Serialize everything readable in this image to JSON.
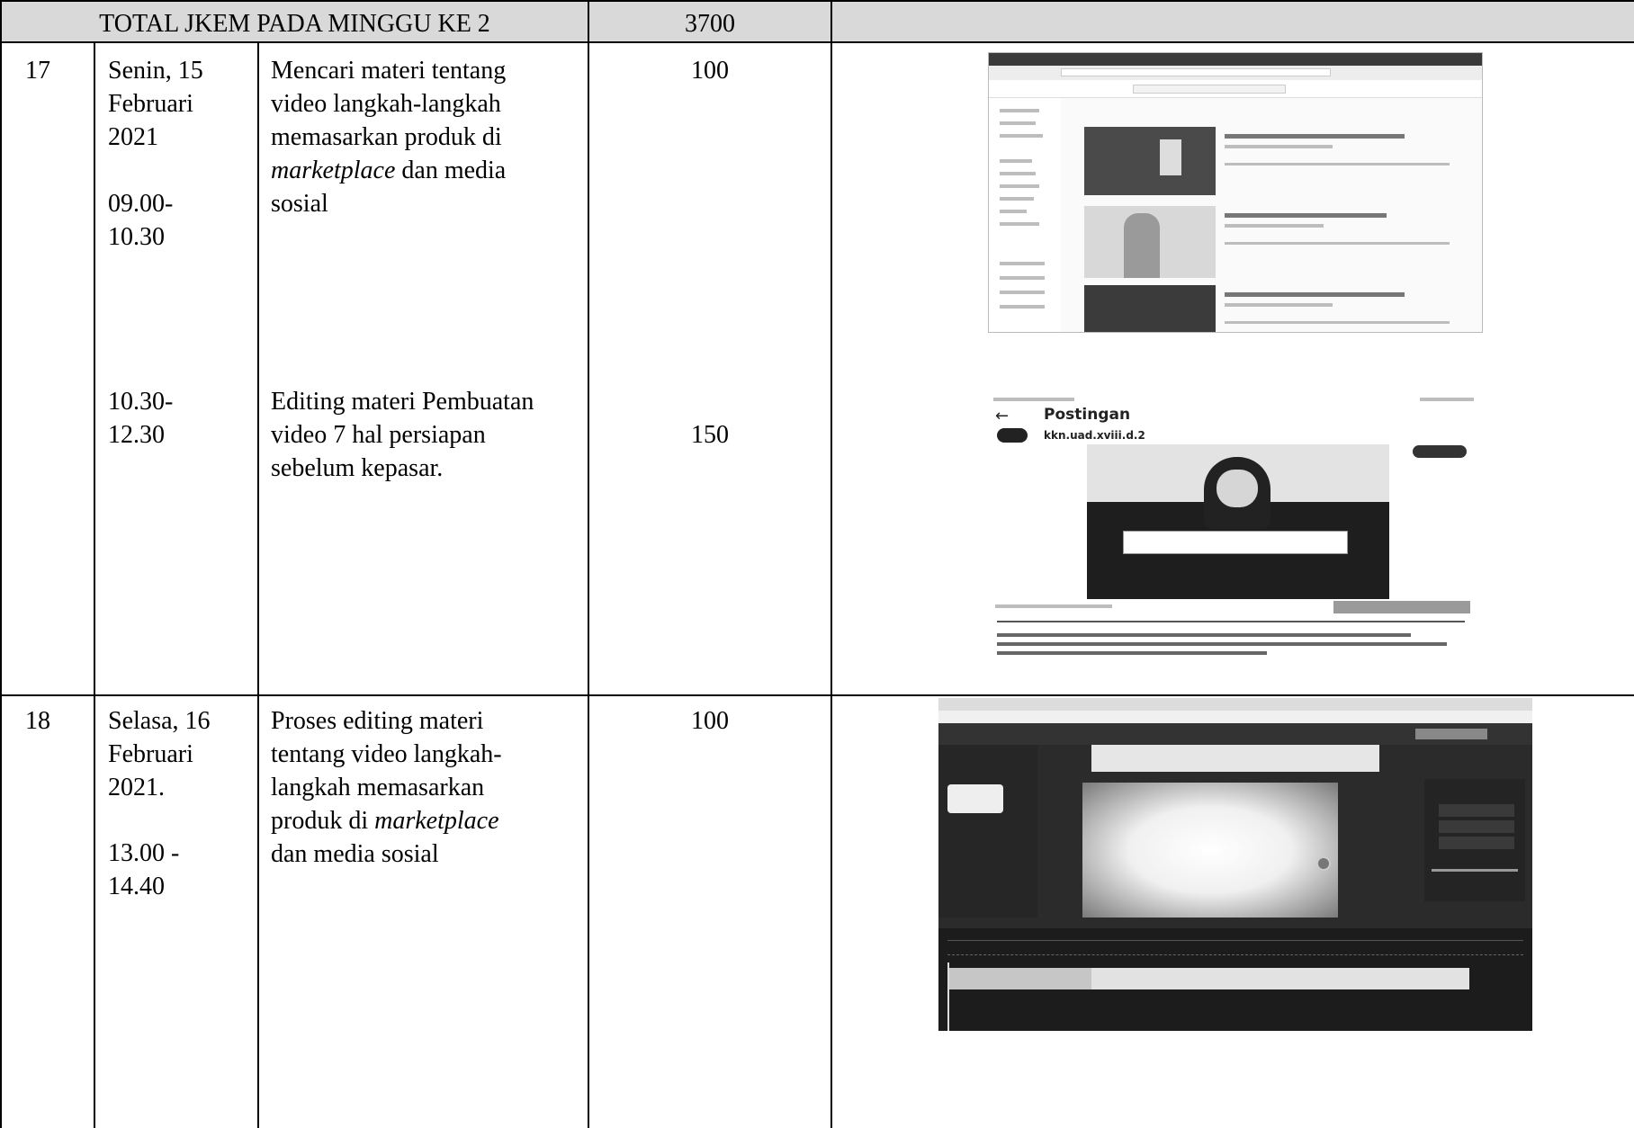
{
  "header": {
    "title": "TOTAL JKEM PADA MINGGU KE 2",
    "total": "3700"
  },
  "rows": [
    {
      "no": "17",
      "date": "Senin, 15\nFebruari\n2021",
      "time1": "09.00-\n10.30",
      "activity1_pre": "Mencari materi tentang\nvideo langkah-langkah\nmemasarkan produk di\n",
      "activity1_italic": "marketplace",
      "activity1_post": " dan media\nsosial",
      "jkem1": "100",
      "time2": "10.30-\n12.30",
      "activity2": "Editing materi Pembuatan\nvideo 7 hal persiapan\nsebelum kepasar.",
      "jkem2": "150"
    },
    {
      "no": "18",
      "date": "Selasa, 16\nFebruari\n2021.",
      "time1": "13.00 -\n14.40",
      "activity1_pre": "Proses editing materi\ntentang video langkah-\nlangkah memasarkan\nproduk di ",
      "activity1_italic": "marketplace",
      "activity1_post": "\ndan media sosial",
      "jkem1": "100"
    }
  ],
  "screenshots": {
    "instagram_title": "Postingan",
    "instagram_account": "kkn.uad.xviii.d.2"
  }
}
